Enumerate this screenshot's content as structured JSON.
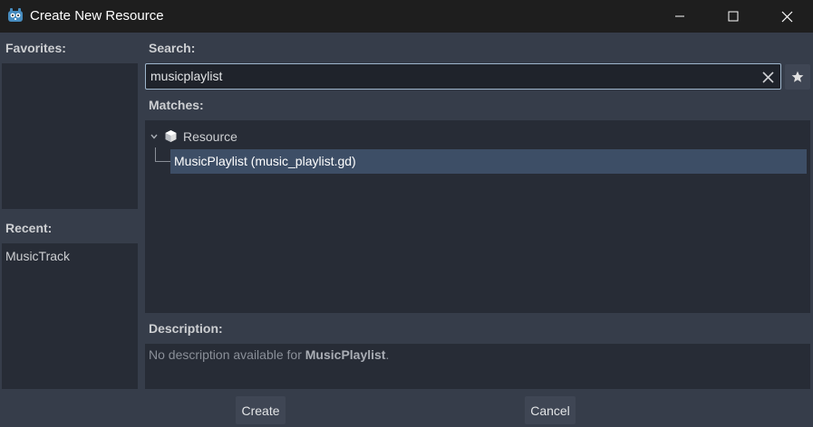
{
  "window": {
    "title": "Create New Resource"
  },
  "favorites": {
    "label": "Favorites:"
  },
  "recent": {
    "label": "Recent:",
    "items": [
      "MusicTrack"
    ]
  },
  "search": {
    "label": "Search:",
    "value": "musicplaylist"
  },
  "matches": {
    "label": "Matches:",
    "tree": {
      "root_label": "Resource",
      "child_label": "MusicPlaylist (music_playlist.gd)"
    }
  },
  "description": {
    "label": "Description:",
    "prefix": "No description available for ",
    "name": "MusicPlaylist",
    "suffix": "."
  },
  "buttons": {
    "create": "Create",
    "cancel": "Cancel"
  },
  "colors": {
    "background": "#363d4a",
    "panel": "#272c36",
    "titlebar": "#1e1e1e",
    "selection": "#3d4e66",
    "focus_border": "#9fb6cd"
  }
}
